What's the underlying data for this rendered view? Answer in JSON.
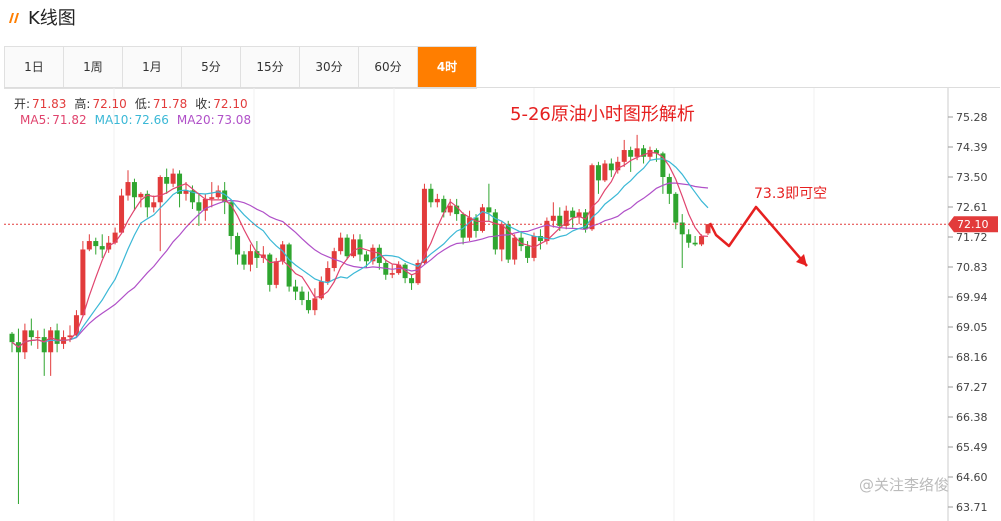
{
  "app": {
    "title": "K线图"
  },
  "tabs": [
    "1日",
    "1周",
    "1月",
    "5分",
    "15分",
    "30分",
    "60分",
    "4时"
  ],
  "active_tab": 7,
  "ohlc": {
    "open_label": "开:",
    "open": "71.83",
    "high_label": "高:",
    "high": "72.10",
    "low_label": "低:",
    "low": "71.78",
    "close_label": "收:",
    "close": "72.10"
  },
  "ma": {
    "ma5_label": "MA5:",
    "ma5": "71.82",
    "ma10_label": "MA10:",
    "ma10": "72.66",
    "ma20_label": "MA20:",
    "ma20": "73.08"
  },
  "annotation_title": "5-26原油小时图形解析",
  "annotation_target": "73.3即可空",
  "watermark": "@关注李络俊",
  "colors": {
    "up": "#e23b3b",
    "down": "#2fa52f",
    "ma5": "#e0446e",
    "ma10": "#3bb8d6",
    "ma20": "#b050c8",
    "accent": "#ff7e00",
    "price_line": "#e23b3b",
    "annotation": "#e62020"
  },
  "chart_data": {
    "type": "candlestick",
    "y_ticks": [
      "75.28",
      "74.39",
      "73.50",
      "72.61",
      "71.72",
      "70.83",
      "69.94",
      "69.05",
      "68.16",
      "67.27",
      "66.38",
      "65.49",
      "64.60",
      "63.71"
    ],
    "ylim": [
      63.71,
      75.28
    ],
    "current_price": "72.10",
    "candles": [
      [
        68.85,
        68.6,
        68.9,
        68.3
      ],
      [
        68.6,
        68.3,
        69.0,
        63.8
      ],
      [
        68.3,
        68.95,
        69.15,
        68.1
      ],
      [
        68.95,
        68.75,
        69.3,
        68.5
      ],
      [
        68.75,
        68.75,
        68.95,
        68.4
      ],
      [
        68.75,
        68.3,
        69.0,
        67.6
      ],
      [
        68.3,
        68.95,
        69.05,
        67.6
      ],
      [
        68.95,
        68.55,
        69.15,
        68.3
      ],
      [
        68.55,
        68.75,
        68.95,
        68.4
      ],
      [
        68.75,
        68.8,
        69.1,
        68.6
      ],
      [
        68.8,
        69.4,
        69.55,
        68.75
      ],
      [
        69.4,
        71.35,
        71.6,
        69.4
      ],
      [
        71.35,
        71.6,
        71.8,
        71.3
      ],
      [
        71.6,
        71.45,
        71.7,
        71.2
      ],
      [
        71.45,
        71.35,
        71.8,
        71.1
      ],
      [
        71.35,
        71.55,
        71.75,
        71.25
      ],
      [
        71.55,
        71.85,
        72.0,
        71.5
      ],
      [
        71.85,
        72.95,
        73.15,
        71.85
      ],
      [
        72.95,
        73.35,
        73.7,
        72.8
      ],
      [
        73.35,
        72.9,
        73.45,
        72.5
      ],
      [
        72.9,
        73.0,
        73.05,
        72.6
      ],
      [
        73.0,
        72.6,
        73.1,
        72.3
      ],
      [
        72.6,
        72.75,
        72.95,
        72.45
      ],
      [
        72.75,
        73.5,
        73.55,
        71.3
      ],
      [
        73.5,
        73.3,
        73.75,
        73.0
      ],
      [
        73.3,
        73.6,
        73.75,
        73.2
      ],
      [
        73.6,
        73.0,
        73.7,
        72.6
      ],
      [
        73.0,
        73.1,
        73.35,
        72.8
      ],
      [
        73.1,
        72.75,
        73.25,
        72.55
      ],
      [
        72.75,
        72.5,
        73.0,
        72.05
      ],
      [
        72.5,
        72.85,
        73.0,
        72.2
      ],
      [
        72.85,
        72.9,
        73.35,
        72.6
      ],
      [
        72.9,
        73.1,
        73.25,
        72.85
      ],
      [
        73.1,
        72.75,
        73.35,
        72.4
      ],
      [
        72.75,
        71.75,
        72.8,
        71.35
      ],
      [
        71.75,
        71.2,
        71.85,
        70.9
      ],
      [
        71.2,
        70.9,
        71.3,
        70.75
      ],
      [
        70.9,
        71.3,
        71.5,
        70.7
      ],
      [
        71.3,
        71.1,
        71.6,
        70.8
      ],
      [
        71.1,
        71.2,
        71.45,
        70.95
      ],
      [
        71.2,
        70.3,
        71.25,
        70.1
      ],
      [
        70.3,
        71.0,
        71.1,
        70.2
      ],
      [
        71.0,
        71.5,
        71.6,
        70.9
      ],
      [
        71.5,
        70.25,
        71.55,
        70.1
      ],
      [
        70.25,
        70.1,
        70.45,
        69.85
      ],
      [
        70.1,
        69.85,
        70.25,
        69.7
      ],
      [
        69.85,
        69.55,
        70.1,
        69.45
      ],
      [
        69.55,
        69.9,
        70.2,
        69.4
      ],
      [
        69.9,
        70.4,
        70.55,
        69.85
      ],
      [
        70.4,
        70.8,
        71.0,
        70.3
      ],
      [
        70.8,
        71.3,
        71.4,
        70.7
      ],
      [
        71.3,
        71.7,
        71.85,
        71.2
      ],
      [
        71.7,
        71.15,
        71.8,
        71.05
      ],
      [
        71.15,
        71.65,
        71.8,
        71.1
      ],
      [
        71.65,
        71.2,
        71.8,
        71.0
      ],
      [
        71.2,
        71.0,
        71.3,
        70.8
      ],
      [
        71.0,
        71.4,
        71.5,
        70.9
      ],
      [
        71.4,
        70.95,
        71.5,
        70.75
      ],
      [
        70.95,
        70.6,
        71.05,
        70.45
      ],
      [
        70.6,
        70.65,
        70.9,
        70.5
      ],
      [
        70.65,
        70.9,
        71.0,
        70.6
      ],
      [
        70.9,
        70.5,
        70.95,
        70.35
      ],
      [
        70.5,
        70.35,
        70.6,
        70.15
      ],
      [
        70.35,
        70.95,
        71.05,
        70.3
      ],
      [
        70.95,
        73.15,
        73.3,
        70.9
      ],
      [
        73.15,
        72.75,
        73.3,
        72.6
      ],
      [
        72.75,
        72.85,
        73.0,
        72.6
      ],
      [
        72.85,
        72.45,
        72.95,
        72.3
      ],
      [
        72.45,
        72.65,
        72.85,
        72.35
      ],
      [
        72.65,
        72.4,
        72.85,
        72.2
      ],
      [
        72.4,
        71.7,
        72.45,
        71.5
      ],
      [
        71.7,
        72.3,
        72.5,
        71.6
      ],
      [
        72.3,
        71.9,
        72.4,
        71.7
      ],
      [
        71.9,
        72.6,
        72.7,
        71.85
      ],
      [
        72.6,
        72.45,
        73.3,
        72.2
      ],
      [
        72.45,
        71.35,
        72.55,
        71.2
      ],
      [
        71.35,
        72.1,
        72.2,
        71.0
      ],
      [
        72.1,
        71.05,
        72.2,
        70.95
      ],
      [
        71.05,
        71.7,
        71.8,
        70.9
      ],
      [
        71.7,
        71.45,
        71.9,
        71.3
      ],
      [
        71.45,
        71.1,
        71.6,
        70.95
      ],
      [
        71.1,
        71.75,
        71.85,
        71.0
      ],
      [
        71.75,
        71.6,
        71.95,
        71.35
      ],
      [
        71.6,
        72.2,
        72.3,
        71.5
      ],
      [
        72.2,
        72.35,
        72.75,
        72.0
      ],
      [
        72.35,
        72.05,
        72.6,
        71.9
      ],
      [
        72.05,
        72.5,
        72.65,
        71.95
      ],
      [
        72.5,
        72.3,
        72.6,
        72.0
      ],
      [
        72.3,
        72.45,
        72.55,
        72.1
      ],
      [
        72.45,
        71.95,
        72.55,
        71.85
      ],
      [
        71.95,
        73.85,
        73.9,
        71.9
      ],
      [
        73.85,
        73.4,
        73.95,
        73.0
      ],
      [
        73.4,
        73.9,
        74.0,
        73.35
      ],
      [
        73.9,
        73.7,
        74.05,
        73.5
      ],
      [
        73.7,
        73.95,
        74.1,
        73.6
      ],
      [
        73.95,
        74.3,
        74.6,
        73.8
      ],
      [
        74.3,
        74.1,
        74.4,
        73.65
      ],
      [
        74.1,
        74.35,
        74.75,
        74.0
      ],
      [
        74.35,
        74.1,
        74.45,
        73.9
      ],
      [
        74.1,
        74.3,
        74.4,
        74.0
      ],
      [
        74.3,
        74.2,
        74.35,
        73.95
      ],
      [
        74.2,
        73.5,
        74.25,
        73.0
      ],
      [
        73.5,
        73.0,
        73.6,
        72.7
      ],
      [
        73.0,
        72.15,
        73.05,
        71.95
      ],
      [
        72.15,
        71.8,
        72.4,
        70.8
      ],
      [
        71.8,
        71.55,
        71.95,
        71.4
      ],
      [
        71.55,
        71.5,
        71.75,
        71.45
      ],
      [
        71.5,
        71.75,
        71.8,
        71.45
      ],
      [
        71.83,
        72.1,
        72.1,
        71.78
      ]
    ]
  }
}
